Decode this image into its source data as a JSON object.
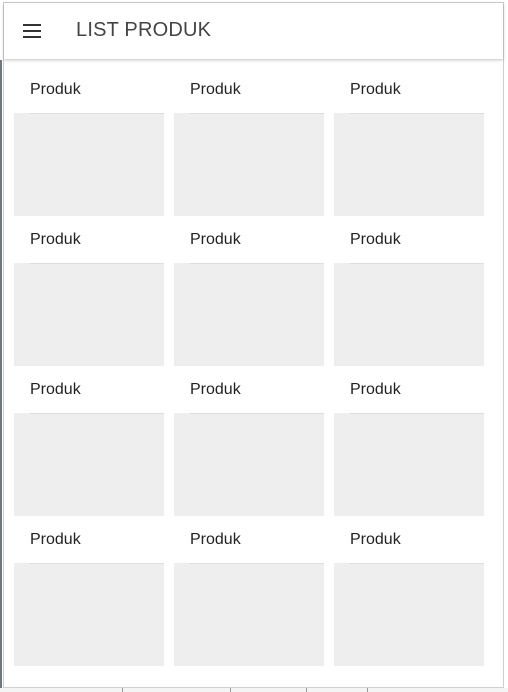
{
  "appbar": {
    "title": "LIST PRODUK",
    "menu_icon": "hamburger-menu-icon"
  },
  "products": [
    {
      "label": "Produk"
    },
    {
      "label": "Produk"
    },
    {
      "label": "Produk"
    },
    {
      "label": "Produk"
    },
    {
      "label": "Produk"
    },
    {
      "label": "Produk"
    },
    {
      "label": "Produk"
    },
    {
      "label": "Produk"
    },
    {
      "label": "Produk"
    },
    {
      "label": "Produk"
    },
    {
      "label": "Produk"
    },
    {
      "label": "Produk"
    }
  ],
  "colors": {
    "appbar_bg": "#ffffff",
    "placeholder_bg": "#eeeeee",
    "text": "#222222"
  }
}
